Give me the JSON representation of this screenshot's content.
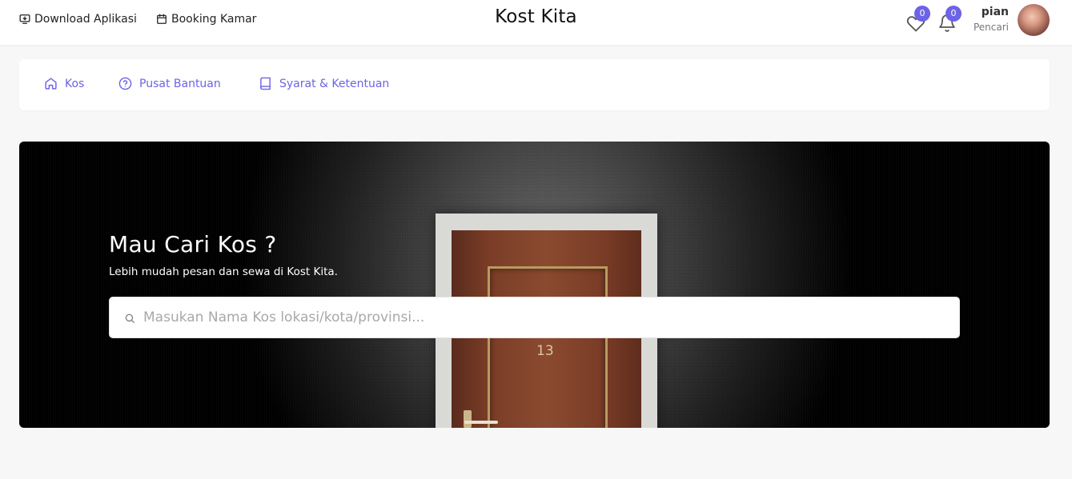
{
  "header": {
    "links": [
      {
        "label": "Download Aplikasi",
        "icon": "monitor-download-icon"
      },
      {
        "label": "Booking Kamar",
        "icon": "calendar-icon"
      }
    ],
    "brand": "Kost Kita",
    "wishlist_count": "0",
    "notification_count": "0",
    "user": {
      "name": "pian",
      "role": "Pencari"
    }
  },
  "nav": {
    "items": [
      {
        "label": "Kos",
        "icon": "home-icon"
      },
      {
        "label": "Pusat Bantuan",
        "icon": "help-circle-icon"
      },
      {
        "label": "Syarat & Ketentuan",
        "icon": "book-icon"
      }
    ]
  },
  "hero": {
    "title": "Mau Cari Kos ?",
    "subtitle": "Lebih mudah pesan dan sewa di Kost Kita.",
    "door_number": "13",
    "search_placeholder": "Masukan Nama Kos lokasi/kota/provinsi..."
  },
  "colors": {
    "accent": "#6c63e6",
    "background": "#f7f7f8"
  }
}
